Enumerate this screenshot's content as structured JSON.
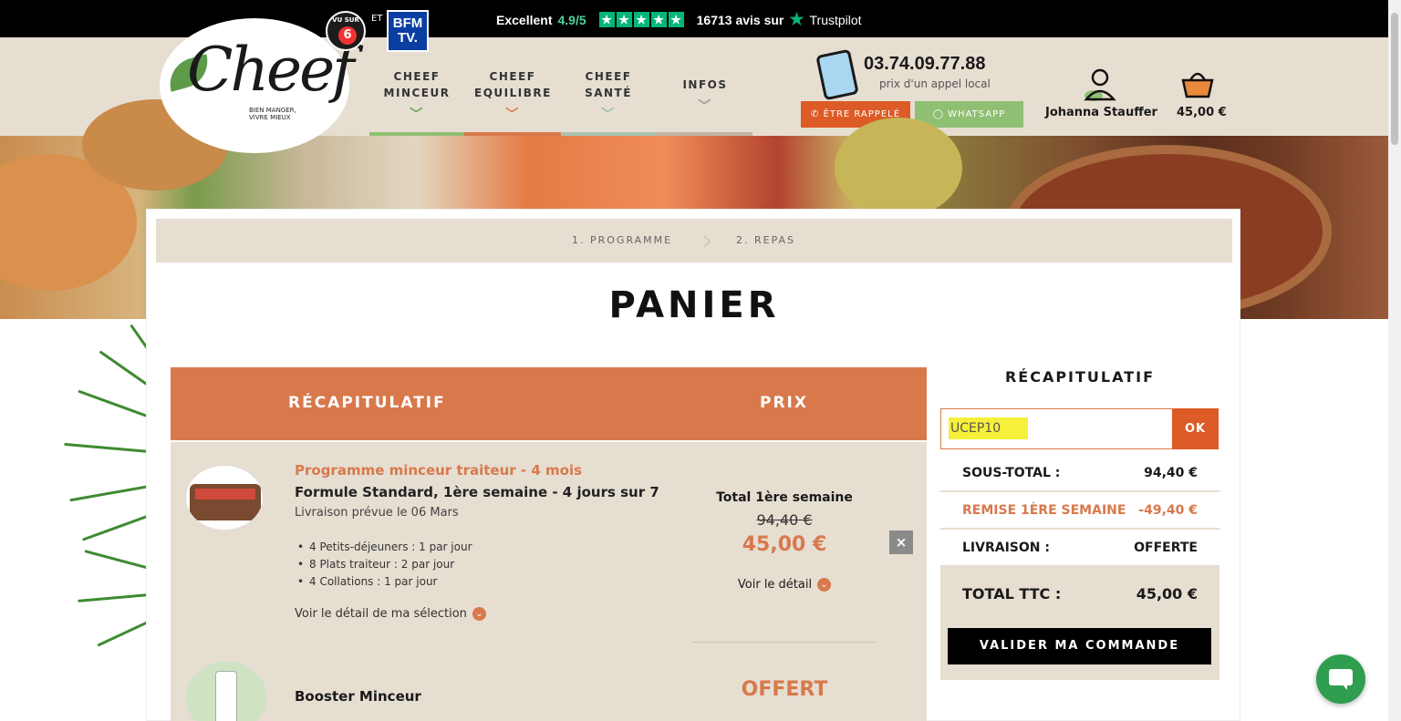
{
  "topbar": {
    "vu_sur": "VU SUR",
    "m6": "6",
    "et": "ET",
    "bfm": "BFM TV.",
    "trustpilot": {
      "excellent": "Excellent",
      "score": "4.9/5",
      "stars": [
        "★",
        "★",
        "★",
        "★",
        "★"
      ],
      "reviews": "16713 avis sur",
      "brand": "Trustpilot"
    }
  },
  "header": {
    "logo": {
      "word": "Cheef",
      "tagline_1": "BIEN MANGER,",
      "tagline_2": "VIVRE MIEUX"
    },
    "nav": [
      {
        "line1": "CHEEF",
        "line2": "MINCEUR",
        "chevron": "﹀"
      },
      {
        "line1": "CHEEF",
        "line2": "EQUILIBRE",
        "chevron": "﹀"
      },
      {
        "line1": "CHEEF",
        "line2": "SANTÉ",
        "chevron": "﹀"
      },
      {
        "line1": "INFOS",
        "line2": "",
        "chevron": "﹀"
      }
    ],
    "nav_line_colors": [
      "#8fbf73",
      "#d8794c",
      "#a9c4b0",
      "#c0b6a4"
    ],
    "phone": "03.74.09.77.88",
    "phone_sub": "prix d'un appel local",
    "rappel_label": "ÊTRE RAPPELÉ",
    "whatsapp_label": "WHATSAPP",
    "user_name": "Johanna Stauffer",
    "cart_total": "45,00 €"
  },
  "steps": {
    "step1": "1. PROGRAMME",
    "step2": "2. REPAS"
  },
  "page_title": "PANIER",
  "table": {
    "col_recap": "RÉCAPITULATIF",
    "col_prix": "PRIX"
  },
  "product1": {
    "name": "Programme minceur traiteur - 4 mois",
    "formule": "Formule Standard, 1ère semaine - 4 jours sur 7",
    "livraison": "Livraison prévue le 06 Mars",
    "items": [
      "4 Petits-déjeuners : 1 par jour",
      "8 Plats traiteur : 2 par jour",
      "4 Collations : 1 par jour"
    ],
    "detail_link": "Voir le détail de ma sélection",
    "total_label": "Total 1ère semaine",
    "old_price": "94,40 €",
    "price": "45,00 €",
    "voir_detail": "Voir le détail",
    "remove": "×"
  },
  "product2": {
    "name": "Booster Minceur",
    "price": "OFFERT"
  },
  "summary": {
    "title": "RÉCAPITULATIF",
    "promo_value": "UCEP10",
    "ok_label": "OK",
    "subtotal_label": "SOUS-TOTAL :",
    "subtotal_value": "94,40 €",
    "remise_label": "REMISE 1ÈRE SEMAINE",
    "remise_value": "-49,40 €",
    "livraison_label": "LIVRAISON :",
    "livraison_value": "OFFERTE",
    "total_label": "TOTAL TTC :",
    "total_value": "45,00 €",
    "valider_label": "VALIDER MA COMMANDE"
  },
  "colors": {
    "accent_orange": "#d8794c",
    "button_orange": "#dc5b27",
    "beige": "#e6ded1",
    "green": "#8fbf73",
    "highlight": "#f6f03a"
  }
}
